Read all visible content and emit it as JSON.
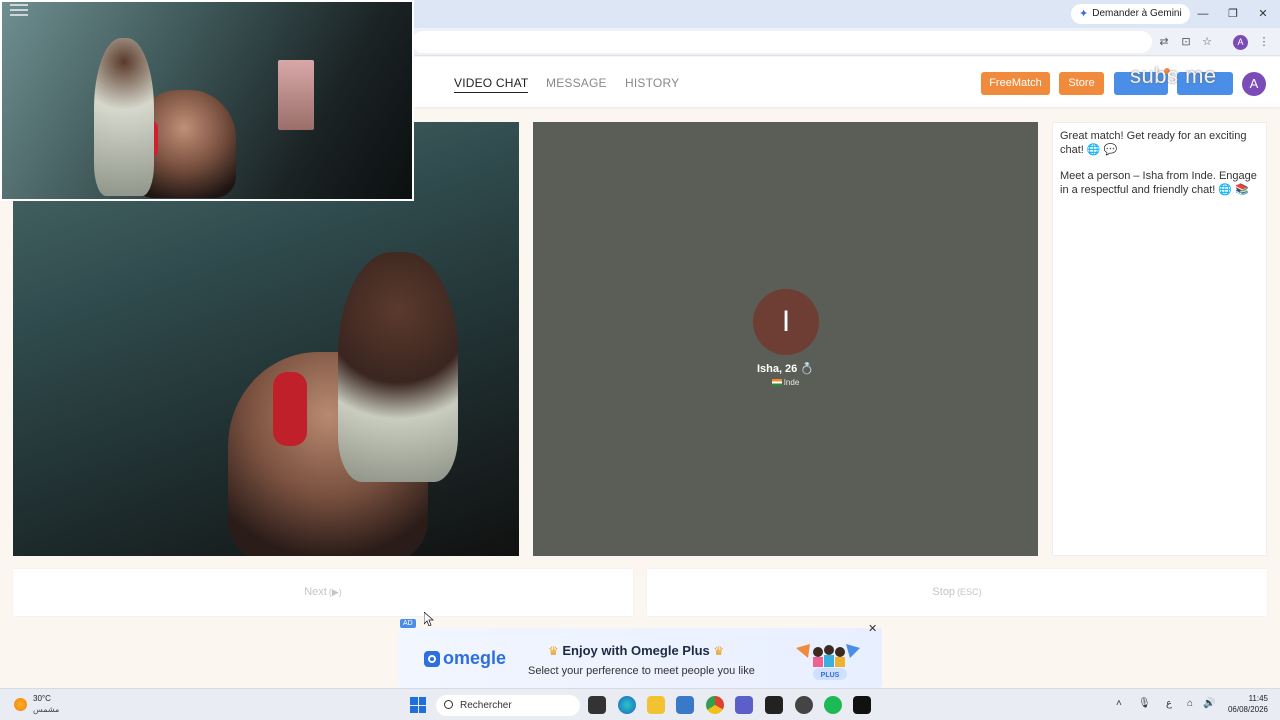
{
  "browser": {
    "gemini_label": "Demander à Gemini",
    "avatar_letter": "A"
  },
  "header": {
    "tabs": [
      {
        "label": "VIDEO CHAT",
        "active": true
      },
      {
        "label": "MESSAGE",
        "active": false
      },
      {
        "label": "HISTORY",
        "active": false
      }
    ],
    "freematch_label": "FreeMatch",
    "store_label": "Store",
    "overlay_text": "subs me",
    "avatar_letter": "A"
  },
  "partner": {
    "initial": "I",
    "name_age": "Isha, 26",
    "country": "Inde"
  },
  "chat": {
    "messages": [
      "Great match! Get ready for an exciting chat! 🌐 💬",
      "Meet a person – Isha from Inde. Engage in a respectful and friendly chat! 🌐 📚"
    ]
  },
  "controls": {
    "next_label": "Next",
    "next_hint": "(▶)",
    "stop_label": "Stop",
    "stop_hint": "(ESC)"
  },
  "ad": {
    "badge": "AD",
    "brand": "omegle",
    "title": "Enjoy with Omegle Plus",
    "subtitle": "Select your perference to meet people you like",
    "plus_tag": "PLUS",
    "close": "✕"
  },
  "taskbar": {
    "temperature": "30°C",
    "condition": "مشمس",
    "search_placeholder": "Rechercher",
    "lang": "ع",
    "time": "11:45",
    "date": "06/08/2026"
  },
  "colors": {
    "accent_orange": "#f08a3c",
    "accent_blue": "#4a8ee8",
    "partner_bg": "#5b5e57",
    "partner_avatar": "#6e3d33",
    "user_avatar": "#7b4bb8"
  }
}
